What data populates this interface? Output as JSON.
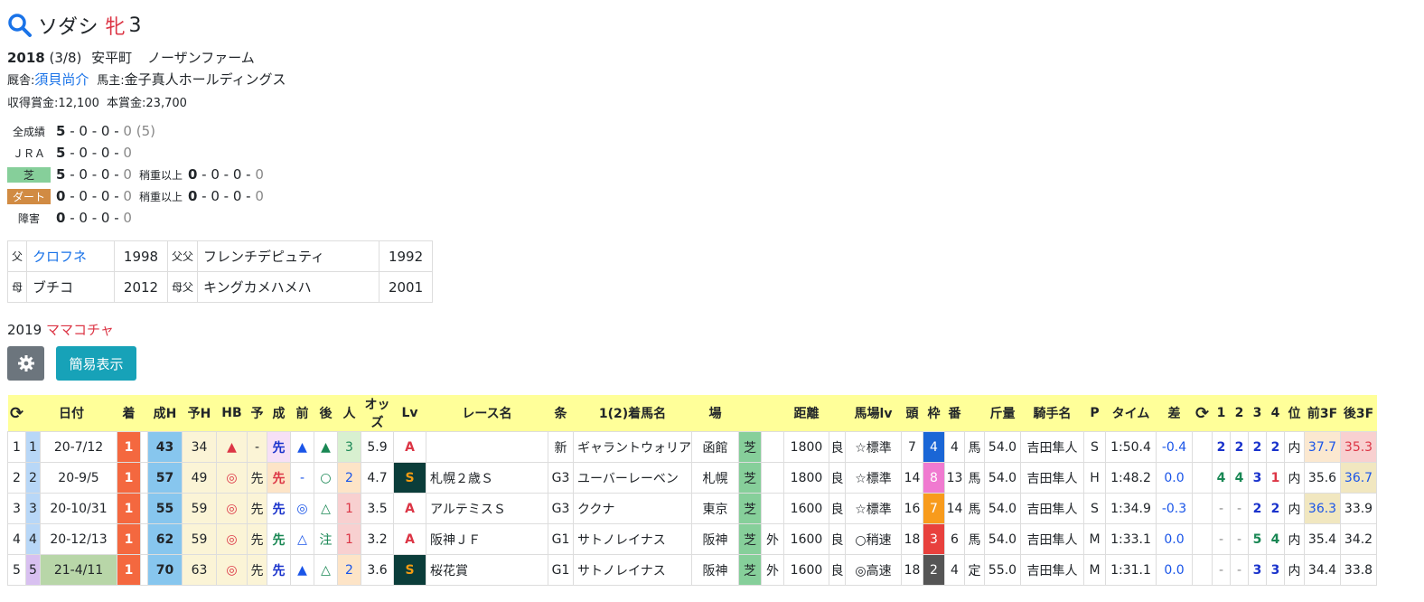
{
  "horse": {
    "name": "ソダシ",
    "sex": "牝",
    "age": "3",
    "birth_year": "2018",
    "birth_date": "(3/8)",
    "birthplace": "安平町",
    "breeder": "ノーザンファーム",
    "stable_label": "厩舎:",
    "trainer": "須貝尚介",
    "owner_label": "馬主:",
    "owner": "金子真人ホールディングス",
    "earnings": "収得賞金:12,100",
    "prize": "本賞金:23,700"
  },
  "stats": [
    {
      "label": "全成績",
      "a": "5",
      "b": "0",
      "c": "0",
      "d": "0",
      "extra": "(5)"
    },
    {
      "label": "ＪＲＡ",
      "a": "5",
      "b": "0",
      "c": "0",
      "d": "0"
    },
    {
      "label": "芝",
      "a": "5",
      "b": "0",
      "c": "0",
      "d": "0",
      "sub": "稍重以上",
      "sa": "0",
      "sb": "0",
      "sc": "0",
      "sd": "0"
    },
    {
      "label": "ダート",
      "a": "0",
      "b": "0",
      "c": "0",
      "d": "0",
      "sub": "稍重以上",
      "sa": "0",
      "sb": "0",
      "sc": "0",
      "sd": "0"
    },
    {
      "label": "障害",
      "a": "0",
      "b": "0",
      "c": "0",
      "d": "0"
    }
  ],
  "pedigree": {
    "sire_label": "父",
    "sire": "クロフネ",
    "sire_year": "1998",
    "ss_label": "父父",
    "ss": "フレンチデピュティ",
    "ss_year": "1992",
    "dam_label": "母",
    "dam": "ブチコ",
    "dam_year": "2012",
    "ds_label": "母父",
    "ds": "キングカメハメハ",
    "ds_year": "2001"
  },
  "offspring": {
    "year": "2019",
    "name": "ママコチャ"
  },
  "buttons": {
    "simple": "簡易表示"
  },
  "table": {
    "headers": [
      "",
      "日付",
      "着",
      "成H",
      "予H",
      "HB",
      "予",
      "成",
      "前",
      "後",
      "人",
      "オッズ",
      "Lv",
      "レース名",
      "条",
      "1(2)着馬名",
      "場",
      "",
      "距離",
      "",
      "馬場lv",
      "頭",
      "枠",
      "番",
      "",
      "斤量",
      "騎手名",
      "P",
      "タイム",
      "差",
      "",
      "1",
      "2",
      "3",
      "4",
      "位",
      "前3F",
      "後3F"
    ],
    "rows": [
      {
        "no": "1",
        "no2": "1",
        "date": "20-7/12",
        "rank": "1",
        "sei": "43",
        "yo": "34",
        "hb": "▲",
        "yo2": "-",
        "sei2": "先",
        "mae": "▲",
        "ato": "▲",
        "ninki": "3",
        "odds": "5.9",
        "lv": "A",
        "race": "",
        "cond": "新",
        "winner": "ギャラントウォリア",
        "place": "函館",
        "surf": "芝",
        "side": "",
        "dist": "1800",
        "baba": "良",
        "babalv": "☆標準",
        "heads": "7",
        "waku": "4",
        "ban": "4",
        "sex": "馬",
        "kin": "54.0",
        "jockey": "吉田隼人",
        "p": "S",
        "time": "1:50.4",
        "diff": "-0.4",
        "c1": "2",
        "c2": "2",
        "c3": "2",
        "c4": "2",
        "pos": "内",
        "mae3": "37.7",
        "ato3": "35.3"
      },
      {
        "no": "2",
        "no2": "2",
        "date": "20-9/5",
        "rank": "1",
        "sei": "57",
        "yo": "49",
        "hb": "◎",
        "yo2": "先",
        "sei2": "先",
        "mae": "-",
        "ato": "○",
        "ninki": "2",
        "odds": "4.7",
        "lv": "S",
        "race": "札幌２歳Ｓ",
        "cond": "G3",
        "winner": "ユーバーレーベン",
        "place": "札幌",
        "surf": "芝",
        "side": "",
        "dist": "1800",
        "baba": "良",
        "babalv": "☆標準",
        "heads": "14",
        "waku": "8",
        "ban": "13",
        "sex": "馬",
        "kin": "54.0",
        "jockey": "吉田隼人",
        "p": "H",
        "time": "1:48.2",
        "diff": "0.0",
        "c1": "4",
        "c2": "4",
        "c3": "3",
        "c4": "1",
        "pos": "内",
        "mae3": "35.6",
        "ato3": "36.7"
      },
      {
        "no": "3",
        "no2": "3",
        "date": "20-10/31",
        "rank": "1",
        "sei": "55",
        "yo": "59",
        "hb": "◎",
        "yo2": "先",
        "sei2": "先",
        "mae": "◎",
        "ato": "△",
        "ninki": "1",
        "odds": "3.5",
        "lv": "A",
        "race": "アルテミスＳ",
        "cond": "G3",
        "winner": "ククナ",
        "place": "東京",
        "surf": "芝",
        "side": "",
        "dist": "1600",
        "baba": "良",
        "babalv": "☆標準",
        "heads": "16",
        "waku": "7",
        "ban": "14",
        "sex": "馬",
        "kin": "54.0",
        "jockey": "吉田隼人",
        "p": "S",
        "time": "1:34.9",
        "diff": "-0.3",
        "c1": "-",
        "c2": "-",
        "c3": "2",
        "c4": "2",
        "pos": "内",
        "mae3": "36.3",
        "ato3": "33.9"
      },
      {
        "no": "4",
        "no2": "4",
        "date": "20-12/13",
        "rank": "1",
        "sei": "62",
        "yo": "59",
        "hb": "◎",
        "yo2": "先",
        "sei2": "先",
        "mae": "△",
        "ato": "注",
        "ninki": "1",
        "odds": "3.2",
        "lv": "A",
        "race": "阪神ＪＦ",
        "cond": "G1",
        "winner": "サトノレイナス",
        "place": "阪神",
        "surf": "芝",
        "side": "外",
        "dist": "1600",
        "baba": "良",
        "babalv": "○稍速",
        "heads": "18",
        "waku": "3",
        "ban": "6",
        "sex": "馬",
        "kin": "54.0",
        "jockey": "吉田隼人",
        "p": "M",
        "time": "1:33.1",
        "diff": "0.0",
        "c1": "-",
        "c2": "-",
        "c3": "5",
        "c4": "4",
        "pos": "内",
        "mae3": "35.4",
        "ato3": "34.2"
      },
      {
        "no": "5",
        "no2": "5",
        "date": "21-4/11",
        "rank": "1",
        "sei": "70",
        "yo": "63",
        "hb": "◎",
        "yo2": "先",
        "sei2": "先",
        "mae": "▲",
        "ato": "△",
        "ninki": "2",
        "odds": "3.6",
        "lv": "S",
        "race": "桜花賞",
        "cond": "G1",
        "winner": "サトノレイナス",
        "place": "阪神",
        "surf": "芝",
        "side": "外",
        "dist": "1600",
        "baba": "良",
        "babalv": "◎高速",
        "heads": "18",
        "waku": "2",
        "ban": "4",
        "sex": "定",
        "kin": "55.0",
        "jockey": "吉田隼人",
        "p": "M",
        "time": "1:31.1",
        "diff": "0.0",
        "c1": "-",
        "c2": "-",
        "c3": "3",
        "c4": "3",
        "pos": "内",
        "mae3": "34.4",
        "ato3": "33.8"
      }
    ]
  }
}
